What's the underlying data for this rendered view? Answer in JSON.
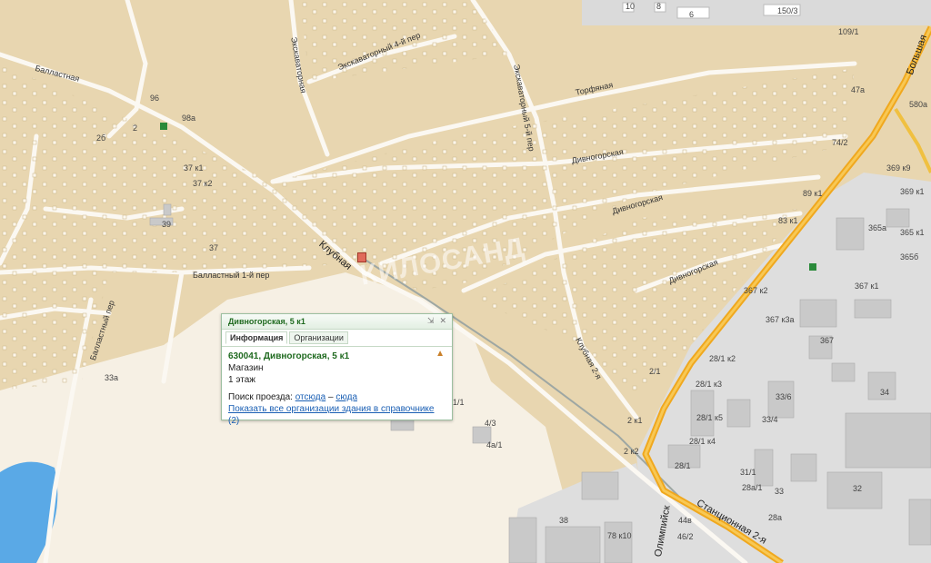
{
  "streets": {
    "ballastnaya": "Балластная",
    "ekskavatornaya": "Экскаваторная",
    "ekskavatorny4": "Экскаваторный 4-й пер",
    "ekskavatorny5": "Экскаваторный 5-й пер",
    "torfyanaya": "Торфяная",
    "divnogorskaya1": "Дивногорская",
    "divnogorskaya2": "Дивногорская",
    "divnogorskaya3": "Дивногорская",
    "klubnaya": "Клубная",
    "klubnaya2": "Клубная 2-я",
    "ballastny1": "Балластный 1-й пер",
    "ballastny_per": "Балластный пер",
    "bolshaya": "Большая",
    "stantsionnaya2": "Станционная 2-я",
    "olimpiyskaya": "Олимпийск"
  },
  "house_numbers": {
    "h10": "10",
    "h8": "8",
    "h6": "6",
    "h150_3": "150/3",
    "h109_1": "109/1",
    "h96": "96",
    "h98a": "98а",
    "h2": "2",
    "h2b": "2б",
    "h37k1": "37 к1",
    "h37k2": "37 к2",
    "h39": "39",
    "h37": "37",
    "h47a": "47а",
    "h580a": "580а",
    "h74_2": "74/2",
    "h369k9": "369 к9",
    "h369k1": "369 к1",
    "h89k1": "89 к1",
    "h83k1": "83 к1",
    "h365a": "365а",
    "h365k1": "365 к1",
    "h365b": "365б",
    "h367k2": "367 к2",
    "h367k1": "367 к1",
    "h367k3a": "367 к3а",
    "h367": "367",
    "h28_1k2": "28/1 к2",
    "h28_1k3": "28/1 к3",
    "h33_6": "33/6",
    "h34": "34",
    "h28_1k5": "28/1 к5",
    "h33_4": "33/4",
    "h28_1k4": "28/1 к4",
    "h28_1": "28/1",
    "h31_1": "31/1",
    "h28a_1": "28а/1",
    "h33": "33",
    "h32": "32",
    "h28a": "28а",
    "h2_1": "2/1",
    "h2k1": "2 к1",
    "h2k2": "2 к2",
    "h1_1": "1/1",
    "h4_3": "4/3",
    "h4a_1": "4а/1",
    "h33a": "33а",
    "h38": "38",
    "h78k10": "78 к10",
    "h44b": "44в",
    "h46_2": "46/2"
  },
  "watermark": "КИЛОСАНД",
  "popup": {
    "title": "Дивногорская, 5 к1",
    "tabs": [
      "Информация",
      "Организации"
    ],
    "address": "630041, Дивногорская, 5 к1",
    "type": "Магазин",
    "floors": "1 этаж",
    "route_label": "Поиск проезда:",
    "route_from": "отсюда",
    "route_sep": "–",
    "route_to": "сюда",
    "show_all": "Показать все организации здания в справочнике",
    "show_all_count": "(2)"
  },
  "colors": {
    "land": "#e8d6b0",
    "industrial": "#dcdcdc",
    "highway": "#f0a81e",
    "water": "#5aa9e6",
    "grass": "#f4ede0"
  }
}
